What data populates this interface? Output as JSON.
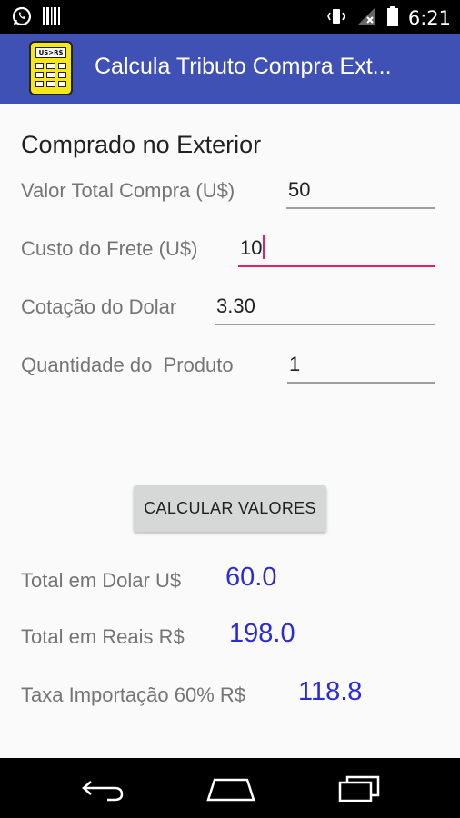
{
  "status_bar": {
    "time": "6:21",
    "icons": [
      "whatsapp-icon",
      "barcode-icon",
      "vibrate-icon",
      "no-signal-icon",
      "battery-icon"
    ]
  },
  "app_bar": {
    "title": "Calcula Tributo Compra Ext...",
    "app_icon_text": "US>R$"
  },
  "form": {
    "section_title": "Comprado no Exterior",
    "fields": [
      {
        "label": "Valor Total Compra (U$)",
        "value": "50"
      },
      {
        "label": "Custo do Frete (U$)",
        "value": "10"
      },
      {
        "label": "Cotação do Dolar",
        "value": "3.30"
      },
      {
        "label": "Quantidade do  Produto",
        "value": "1"
      }
    ]
  },
  "button": {
    "label": "CALCULAR VALORES"
  },
  "results": [
    {
      "label": "Total em Dolar U$",
      "value": "60.0"
    },
    {
      "label": "Total em Reais R$",
      "value": "198.0"
    },
    {
      "label": "Taxa Importação 60% R$",
      "value": "118.8"
    }
  ],
  "colors": {
    "app_bar": "#3f51b5",
    "accent": "#e91e63",
    "result_value": "#2a2ad6"
  },
  "nav_bar": {
    "buttons": [
      "back-icon",
      "home-icon",
      "recents-icon"
    ]
  }
}
